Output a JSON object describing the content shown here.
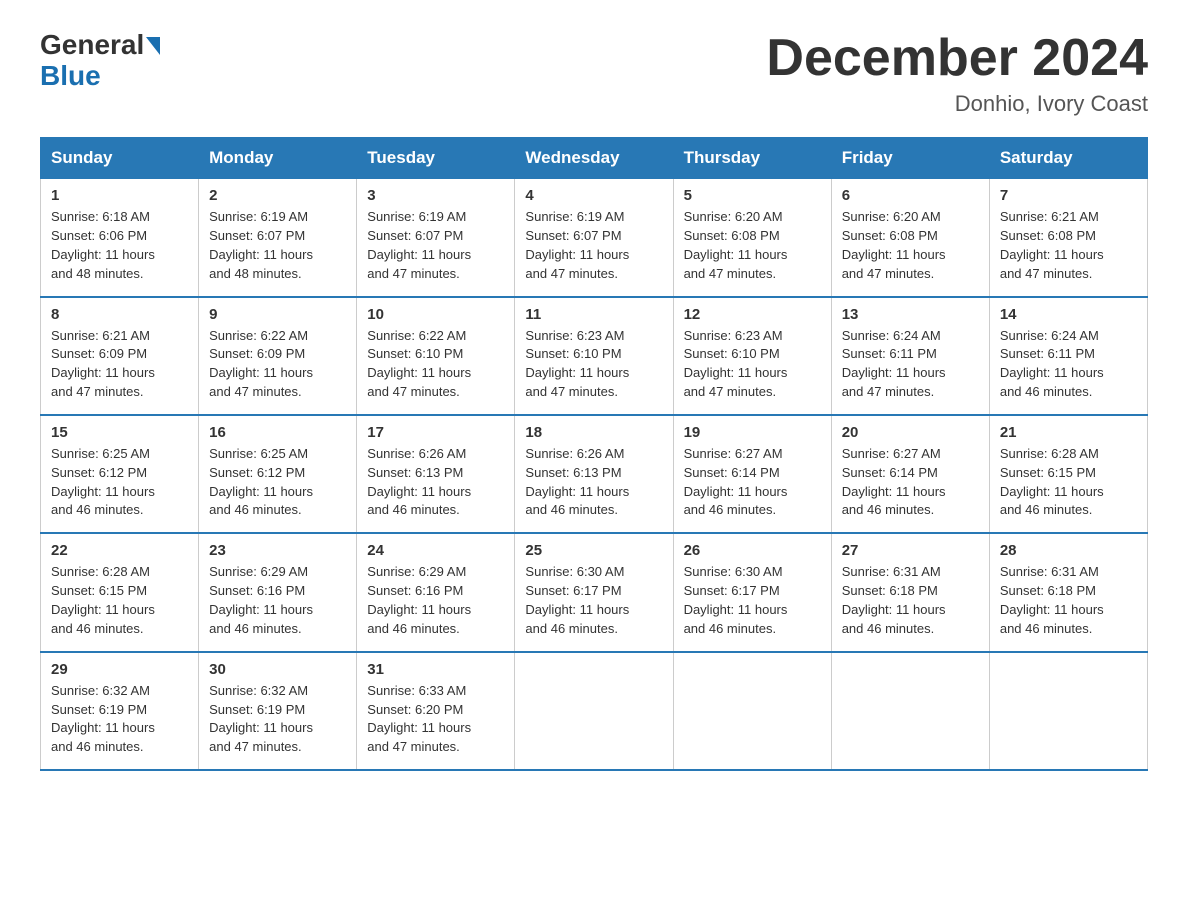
{
  "logo": {
    "text_general": "General",
    "text_blue": "Blue",
    "arrow": true
  },
  "title": {
    "month_year": "December 2024",
    "location": "Donhio, Ivory Coast"
  },
  "headers": [
    "Sunday",
    "Monday",
    "Tuesday",
    "Wednesday",
    "Thursday",
    "Friday",
    "Saturday"
  ],
  "weeks": [
    [
      {
        "day": "1",
        "sunrise": "6:18 AM",
        "sunset": "6:06 PM",
        "daylight": "11 hours and 48 minutes."
      },
      {
        "day": "2",
        "sunrise": "6:19 AM",
        "sunset": "6:07 PM",
        "daylight": "11 hours and 48 minutes."
      },
      {
        "day": "3",
        "sunrise": "6:19 AM",
        "sunset": "6:07 PM",
        "daylight": "11 hours and 47 minutes."
      },
      {
        "day": "4",
        "sunrise": "6:19 AM",
        "sunset": "6:07 PM",
        "daylight": "11 hours and 47 minutes."
      },
      {
        "day": "5",
        "sunrise": "6:20 AM",
        "sunset": "6:08 PM",
        "daylight": "11 hours and 47 minutes."
      },
      {
        "day": "6",
        "sunrise": "6:20 AM",
        "sunset": "6:08 PM",
        "daylight": "11 hours and 47 minutes."
      },
      {
        "day": "7",
        "sunrise": "6:21 AM",
        "sunset": "6:08 PM",
        "daylight": "11 hours and 47 minutes."
      }
    ],
    [
      {
        "day": "8",
        "sunrise": "6:21 AM",
        "sunset": "6:09 PM",
        "daylight": "11 hours and 47 minutes."
      },
      {
        "day": "9",
        "sunrise": "6:22 AM",
        "sunset": "6:09 PM",
        "daylight": "11 hours and 47 minutes."
      },
      {
        "day": "10",
        "sunrise": "6:22 AM",
        "sunset": "6:10 PM",
        "daylight": "11 hours and 47 minutes."
      },
      {
        "day": "11",
        "sunrise": "6:23 AM",
        "sunset": "6:10 PM",
        "daylight": "11 hours and 47 minutes."
      },
      {
        "day": "12",
        "sunrise": "6:23 AM",
        "sunset": "6:10 PM",
        "daylight": "11 hours and 47 minutes."
      },
      {
        "day": "13",
        "sunrise": "6:24 AM",
        "sunset": "6:11 PM",
        "daylight": "11 hours and 47 minutes."
      },
      {
        "day": "14",
        "sunrise": "6:24 AM",
        "sunset": "6:11 PM",
        "daylight": "11 hours and 46 minutes."
      }
    ],
    [
      {
        "day": "15",
        "sunrise": "6:25 AM",
        "sunset": "6:12 PM",
        "daylight": "11 hours and 46 minutes."
      },
      {
        "day": "16",
        "sunrise": "6:25 AM",
        "sunset": "6:12 PM",
        "daylight": "11 hours and 46 minutes."
      },
      {
        "day": "17",
        "sunrise": "6:26 AM",
        "sunset": "6:13 PM",
        "daylight": "11 hours and 46 minutes."
      },
      {
        "day": "18",
        "sunrise": "6:26 AM",
        "sunset": "6:13 PM",
        "daylight": "11 hours and 46 minutes."
      },
      {
        "day": "19",
        "sunrise": "6:27 AM",
        "sunset": "6:14 PM",
        "daylight": "11 hours and 46 minutes."
      },
      {
        "day": "20",
        "sunrise": "6:27 AM",
        "sunset": "6:14 PM",
        "daylight": "11 hours and 46 minutes."
      },
      {
        "day": "21",
        "sunrise": "6:28 AM",
        "sunset": "6:15 PM",
        "daylight": "11 hours and 46 minutes."
      }
    ],
    [
      {
        "day": "22",
        "sunrise": "6:28 AM",
        "sunset": "6:15 PM",
        "daylight": "11 hours and 46 minutes."
      },
      {
        "day": "23",
        "sunrise": "6:29 AM",
        "sunset": "6:16 PM",
        "daylight": "11 hours and 46 minutes."
      },
      {
        "day": "24",
        "sunrise": "6:29 AM",
        "sunset": "6:16 PM",
        "daylight": "11 hours and 46 minutes."
      },
      {
        "day": "25",
        "sunrise": "6:30 AM",
        "sunset": "6:17 PM",
        "daylight": "11 hours and 46 minutes."
      },
      {
        "day": "26",
        "sunrise": "6:30 AM",
        "sunset": "6:17 PM",
        "daylight": "11 hours and 46 minutes."
      },
      {
        "day": "27",
        "sunrise": "6:31 AM",
        "sunset": "6:18 PM",
        "daylight": "11 hours and 46 minutes."
      },
      {
        "day": "28",
        "sunrise": "6:31 AM",
        "sunset": "6:18 PM",
        "daylight": "11 hours and 46 minutes."
      }
    ],
    [
      {
        "day": "29",
        "sunrise": "6:32 AM",
        "sunset": "6:19 PM",
        "daylight": "11 hours and 46 minutes."
      },
      {
        "day": "30",
        "sunrise": "6:32 AM",
        "sunset": "6:19 PM",
        "daylight": "11 hours and 47 minutes."
      },
      {
        "day": "31",
        "sunrise": "6:33 AM",
        "sunset": "6:20 PM",
        "daylight": "11 hours and 47 minutes."
      },
      null,
      null,
      null,
      null
    ]
  ],
  "labels": {
    "sunrise": "Sunrise:",
    "sunset": "Sunset:",
    "daylight": "Daylight:"
  }
}
